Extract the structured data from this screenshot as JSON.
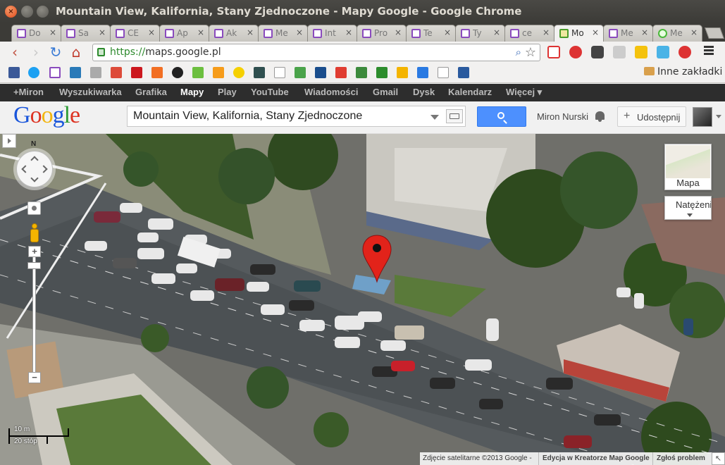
{
  "window": {
    "title": "Mountain View, Kalifornia, Stany Zjednoczone - Mapy Google - Google Chrome"
  },
  "tabs": [
    {
      "label": "Do",
      "icon": "document-icon"
    },
    {
      "label": "Sa",
      "icon": "document-icon"
    },
    {
      "label": "CE",
      "icon": "document-icon"
    },
    {
      "label": "Ap",
      "icon": "document-icon"
    },
    {
      "label": "Ak",
      "icon": "document-icon"
    },
    {
      "label": "Me",
      "icon": "document-icon"
    },
    {
      "label": "Int",
      "icon": "document-icon"
    },
    {
      "label": "Pro",
      "icon": "document-icon"
    },
    {
      "label": "Te",
      "icon": "document-icon"
    },
    {
      "label": "Ty",
      "icon": "document-icon"
    },
    {
      "label": "ce",
      "icon": "document-icon"
    },
    {
      "label": "Mo",
      "icon": "google-maps-icon",
      "active": true
    },
    {
      "label": "Me",
      "icon": "document-icon"
    },
    {
      "label": "Me",
      "icon": "globe-icon"
    }
  ],
  "toolbar": {
    "url_scheme": "https://",
    "url_host": "maps.google.pl"
  },
  "bookmarks": {
    "other_label": "Inne zakładki"
  },
  "gbar": {
    "items": [
      "+Miron",
      "Wyszukiwarka",
      "Grafika",
      "Mapy",
      "Play",
      "YouTube",
      "Wiadomości",
      "Gmail",
      "Dysk",
      "Kalendarz",
      "Więcej ▾"
    ],
    "active_index": 3
  },
  "header": {
    "logo": "Google",
    "search_value": "Mountain View, Kalifornia, Stany Zjednoczone",
    "user_name": "Miron Nurski",
    "share_label": "Udostępnij"
  },
  "map": {
    "compass_label": "N",
    "maptype_label": "Mapa",
    "traffic_label": "Natężenie",
    "scale_metric": "10 m",
    "scale_imperial": "20 stóp",
    "footer_imagery": "Zdjęcie satelitarne ©2013 Google -",
    "footer_mapmaker": "Edycja w Kreatorze Map Google",
    "footer_report": "Zgłoś problem",
    "marker_color": "#e2231a"
  }
}
